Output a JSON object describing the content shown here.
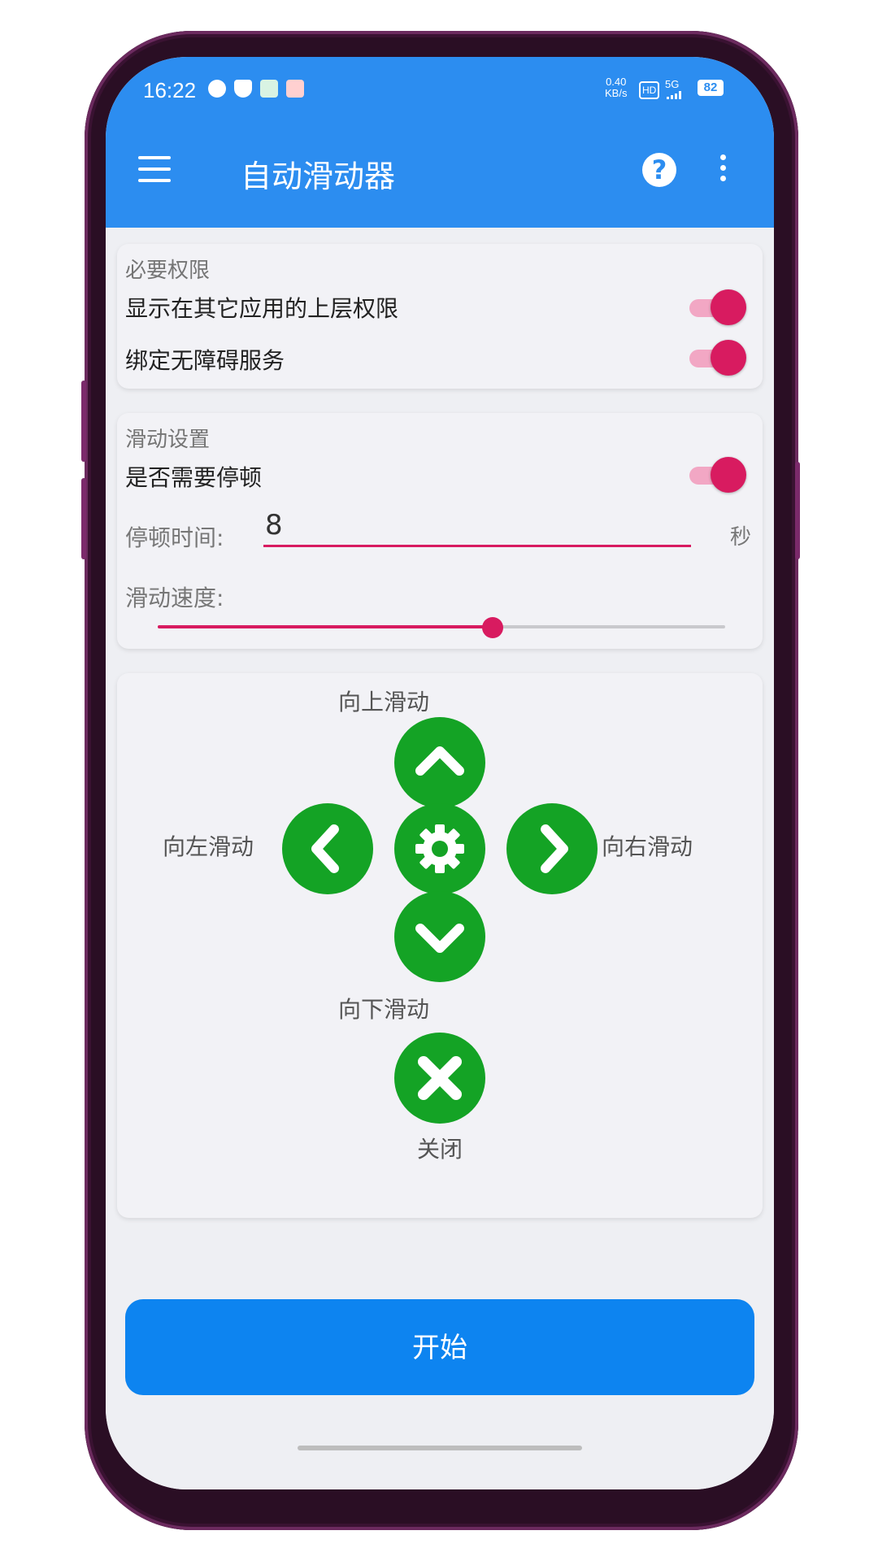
{
  "status_bar": {
    "time": "16:22",
    "net_speed_value": "0.40",
    "net_speed_unit": "KB/s",
    "hd_badge": "HD",
    "signal_label": "5G",
    "battery": "82"
  },
  "app_bar": {
    "title": "自动滑动器",
    "help_icon": "?"
  },
  "permissions": {
    "title": "必要权限",
    "overlay_label": "显示在其它应用的上层权限",
    "overlay_enabled": true,
    "accessibility_label": "绑定无障碍服务",
    "accessibility_enabled": true
  },
  "swipe_settings": {
    "title": "滑动设置",
    "pause_label": "是否需要停顿",
    "pause_enabled": true,
    "pause_time_label": "停顿时间:",
    "pause_time_value": "8",
    "pause_time_unit": "秒",
    "speed_label": "滑动速度:",
    "speed_fraction": 0.59
  },
  "controls": {
    "up_label": "向上滑动",
    "left_label": "向左滑动",
    "right_label": "向右滑动",
    "down_label": "向下滑动",
    "close_label": "关闭",
    "button_color": "#14a325"
  },
  "start_button": {
    "label": "开始"
  },
  "colors": {
    "primary": "#2c8df0",
    "accent": "#d81b60",
    "start": "#0d84f0"
  }
}
